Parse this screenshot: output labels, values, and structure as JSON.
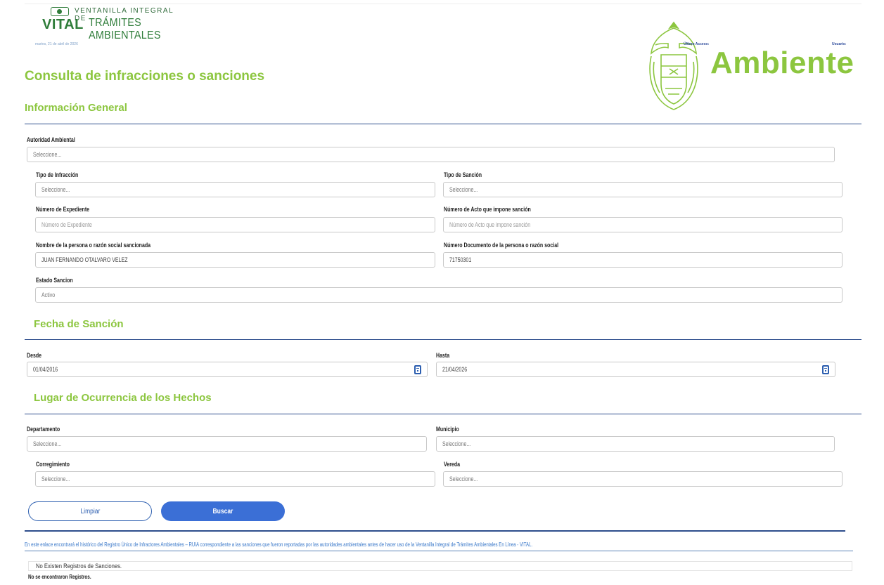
{
  "header": {
    "vital_word": "VITAL",
    "tagline_1": "VENTANILLA INTEGRAL DE",
    "tagline_2": "TRÁMITES AMBIENTALES",
    "date": "martes, 21 de abril de 2026",
    "brand": "Ambiente",
    "last_access": "Último Acceso:",
    "user": "Usuario:"
  },
  "page": {
    "title": "Consulta de infracciones o sanciones"
  },
  "general": {
    "section_title": "Información General",
    "autoridad_label": "Autoridad Ambiental",
    "autoridad_value": "Seleccione...",
    "tipo_infraccion_label": "Tipo de Infracción",
    "tipo_infraccion_value": "Seleccione...",
    "tipo_sancion_label": "Tipo de Sanción",
    "tipo_sancion_value": "Seleccione...",
    "expediente_label": "Número de Expediente",
    "expediente_placeholder": "Número de Expediente",
    "acto_label": "Número de Acto que impone sanción",
    "acto_placeholder": "Número de Acto que impone sanción",
    "nombre_label": "Nombre de la persona o razón social sancionada",
    "nombre_value": "JUAN FERNANDO OTALVARO VELEZ",
    "documento_label": "Número Documento de la persona o razón social",
    "documento_value": "71750301",
    "estado_label": "Estado Sancion",
    "estado_value": "Activo"
  },
  "fecha": {
    "section_title": "Fecha de Sanción",
    "desde_label": "Desde",
    "desde_value": "01/04/2016",
    "hasta_label": "Hasta",
    "hasta_value": "21/04/2026"
  },
  "lugar": {
    "section_title": "Lugar de Ocurrencia de los Hechos",
    "departamento_label": "Departamento",
    "departamento_value": "Seleccione...",
    "municipio_label": "Municipio",
    "municipio_value": "Seleccione...",
    "corregimiento_label": "Corregimiento",
    "corregimiento_value": "Seleccione...",
    "vereda_label": "Vereda",
    "vereda_value": "Seleccione..."
  },
  "actions": {
    "clear_label": "Limpiar",
    "search_label": "Buscar"
  },
  "footer": {
    "ruia_link": "En este enlace encontrará el histórico del Registro Único de Infractores Ambientales – RUIA correspondiente a las sanciones que fueron reportadas por las autoridades ambientales antes de hacer uso de la Ventanilla Integral de Trámites Ambientales En Línea - VITAL.",
    "results_message": "No Existen Registros de Sanciones.",
    "no_records": "No se encontraron Registros."
  },
  "colors": {
    "accent_green": "#8cc63f",
    "brand_dark_green": "#2f7d3a",
    "primary_blue": "#3b6fd6",
    "divider_blue": "#2d4d8c"
  }
}
